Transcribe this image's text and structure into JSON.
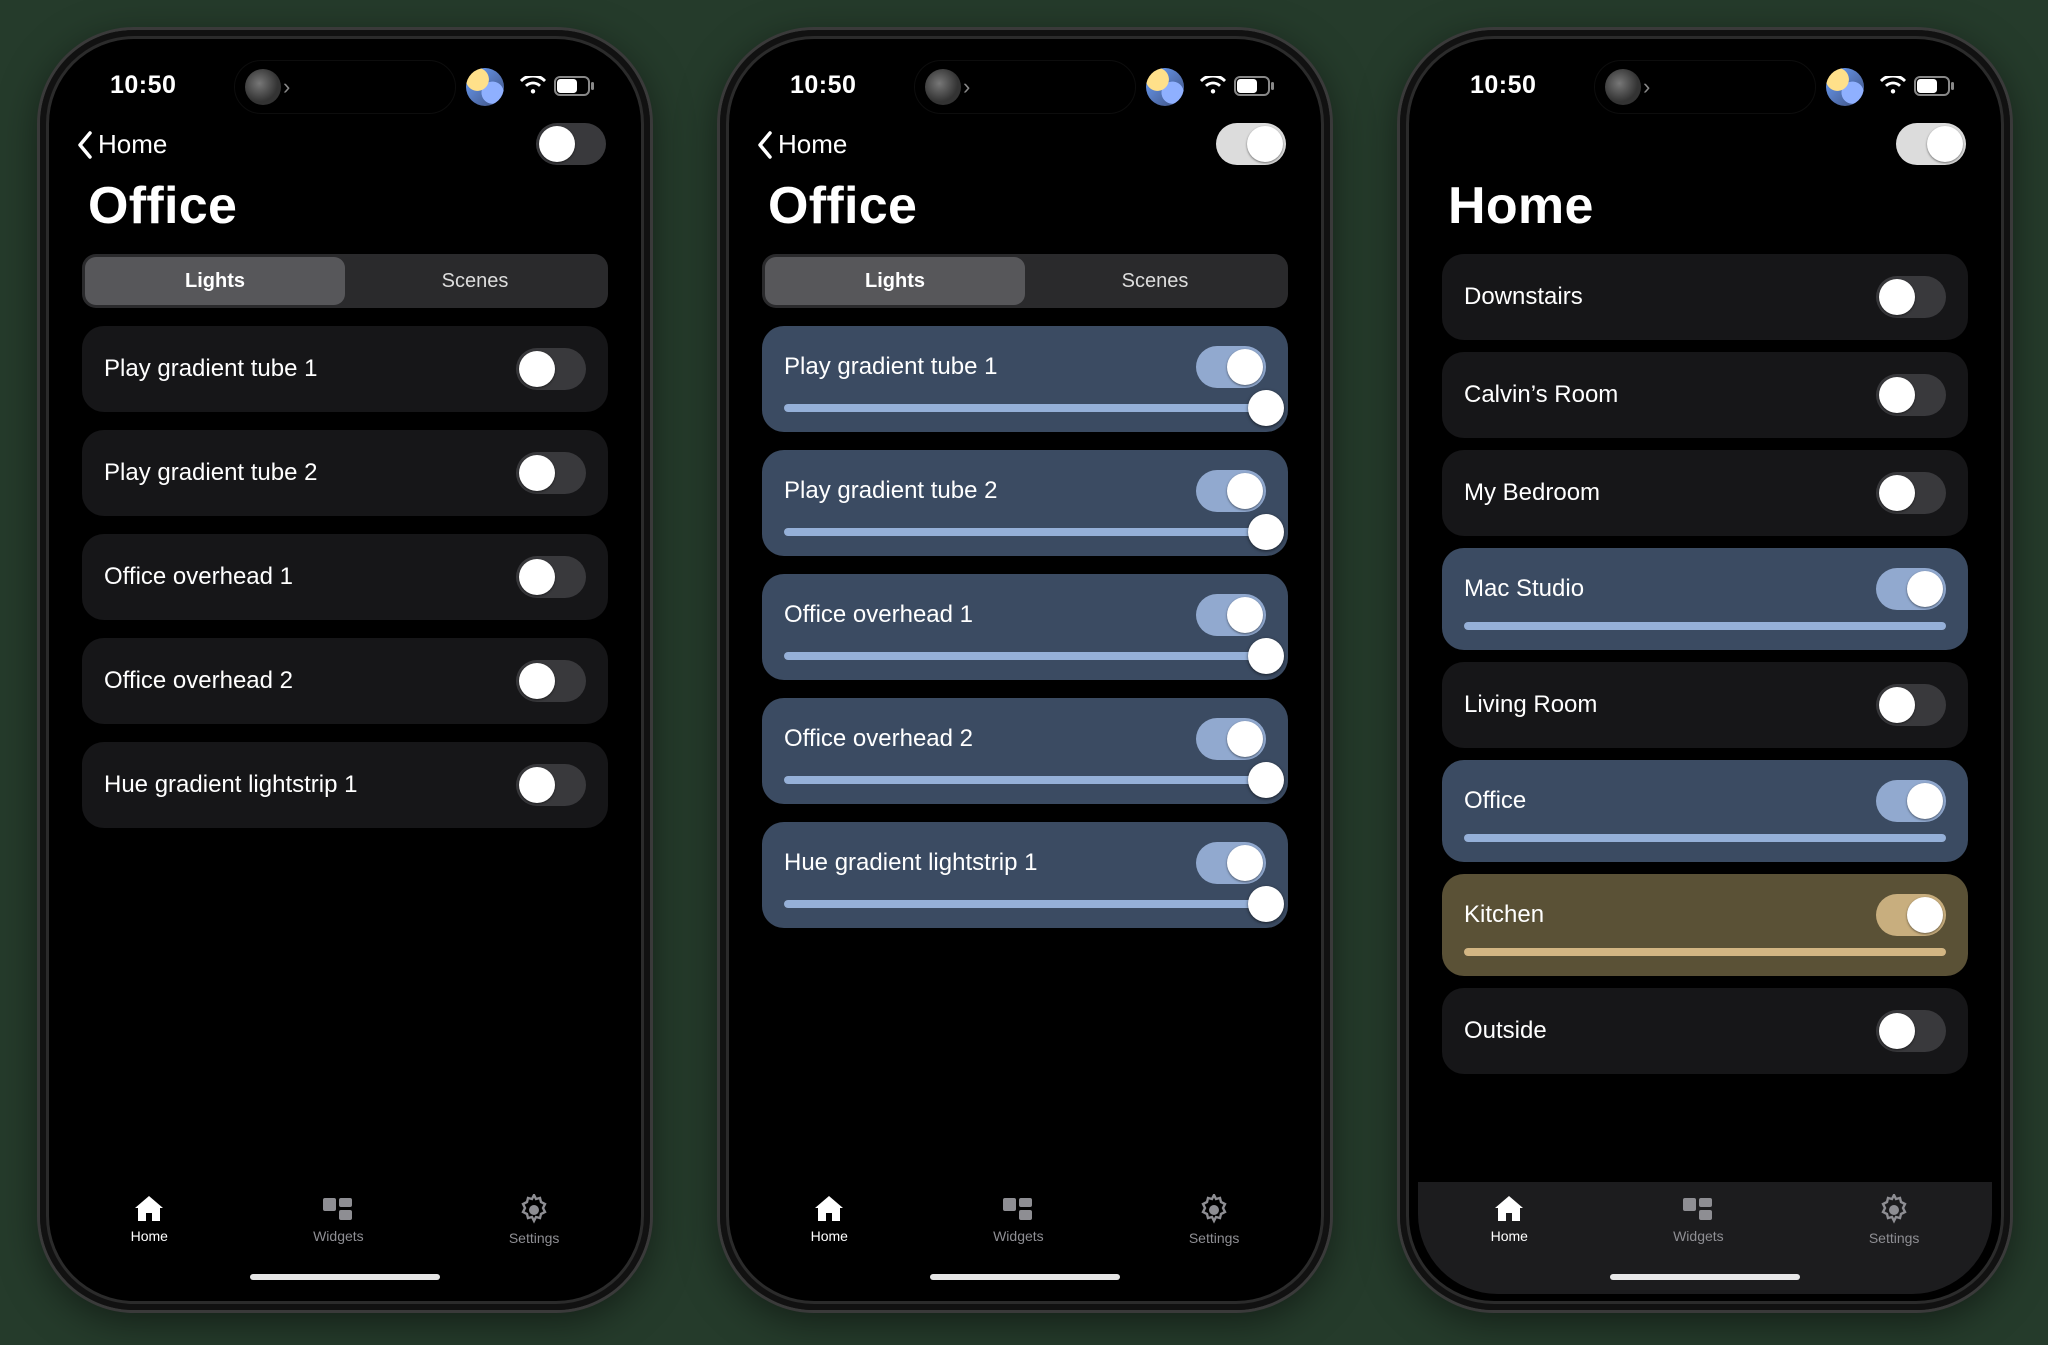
{
  "status_time": "10:50",
  "back_label": "Home",
  "titles": {
    "office": "Office",
    "home": "Home"
  },
  "segments": {
    "lights": "Lights",
    "scenes": "Scenes"
  },
  "tabs": {
    "home": "Home",
    "widgets": "Widgets",
    "settings": "Settings"
  },
  "phone1": {
    "lights": [
      {
        "name": "Play gradient tube 1",
        "on": false
      },
      {
        "name": "Play gradient tube 2",
        "on": false
      },
      {
        "name": "Office overhead 1",
        "on": false
      },
      {
        "name": "Office overhead 2",
        "on": false
      },
      {
        "name": "Hue gradient lightstrip 1",
        "on": false
      }
    ]
  },
  "phone2": {
    "lights": [
      {
        "name": "Play gradient tube 1",
        "on": true,
        "brightness": 100
      },
      {
        "name": "Play gradient tube 2",
        "on": true,
        "brightness": 100
      },
      {
        "name": "Office overhead 1",
        "on": true,
        "brightness": 100
      },
      {
        "name": "Office overhead 2",
        "on": true,
        "brightness": 100
      },
      {
        "name": "Hue gradient lightstrip 1",
        "on": true,
        "brightness": 100
      }
    ]
  },
  "phone3": {
    "rooms": [
      {
        "name": "Downstairs",
        "on": false
      },
      {
        "name": "Calvin’s Room",
        "on": false
      },
      {
        "name": "My Bedroom",
        "on": false
      },
      {
        "name": "Mac Studio",
        "on": true,
        "brightness": 100,
        "tint": "blue"
      },
      {
        "name": "Living Room",
        "on": false
      },
      {
        "name": "Office",
        "on": true,
        "brightness": 100,
        "tint": "blue"
      },
      {
        "name": "Kitchen",
        "on": true,
        "brightness": 100,
        "tint": "gold"
      },
      {
        "name": "Outside",
        "on": false
      }
    ]
  },
  "colors": {
    "blue": "#95b0d8",
    "gold": "#d3b683"
  }
}
